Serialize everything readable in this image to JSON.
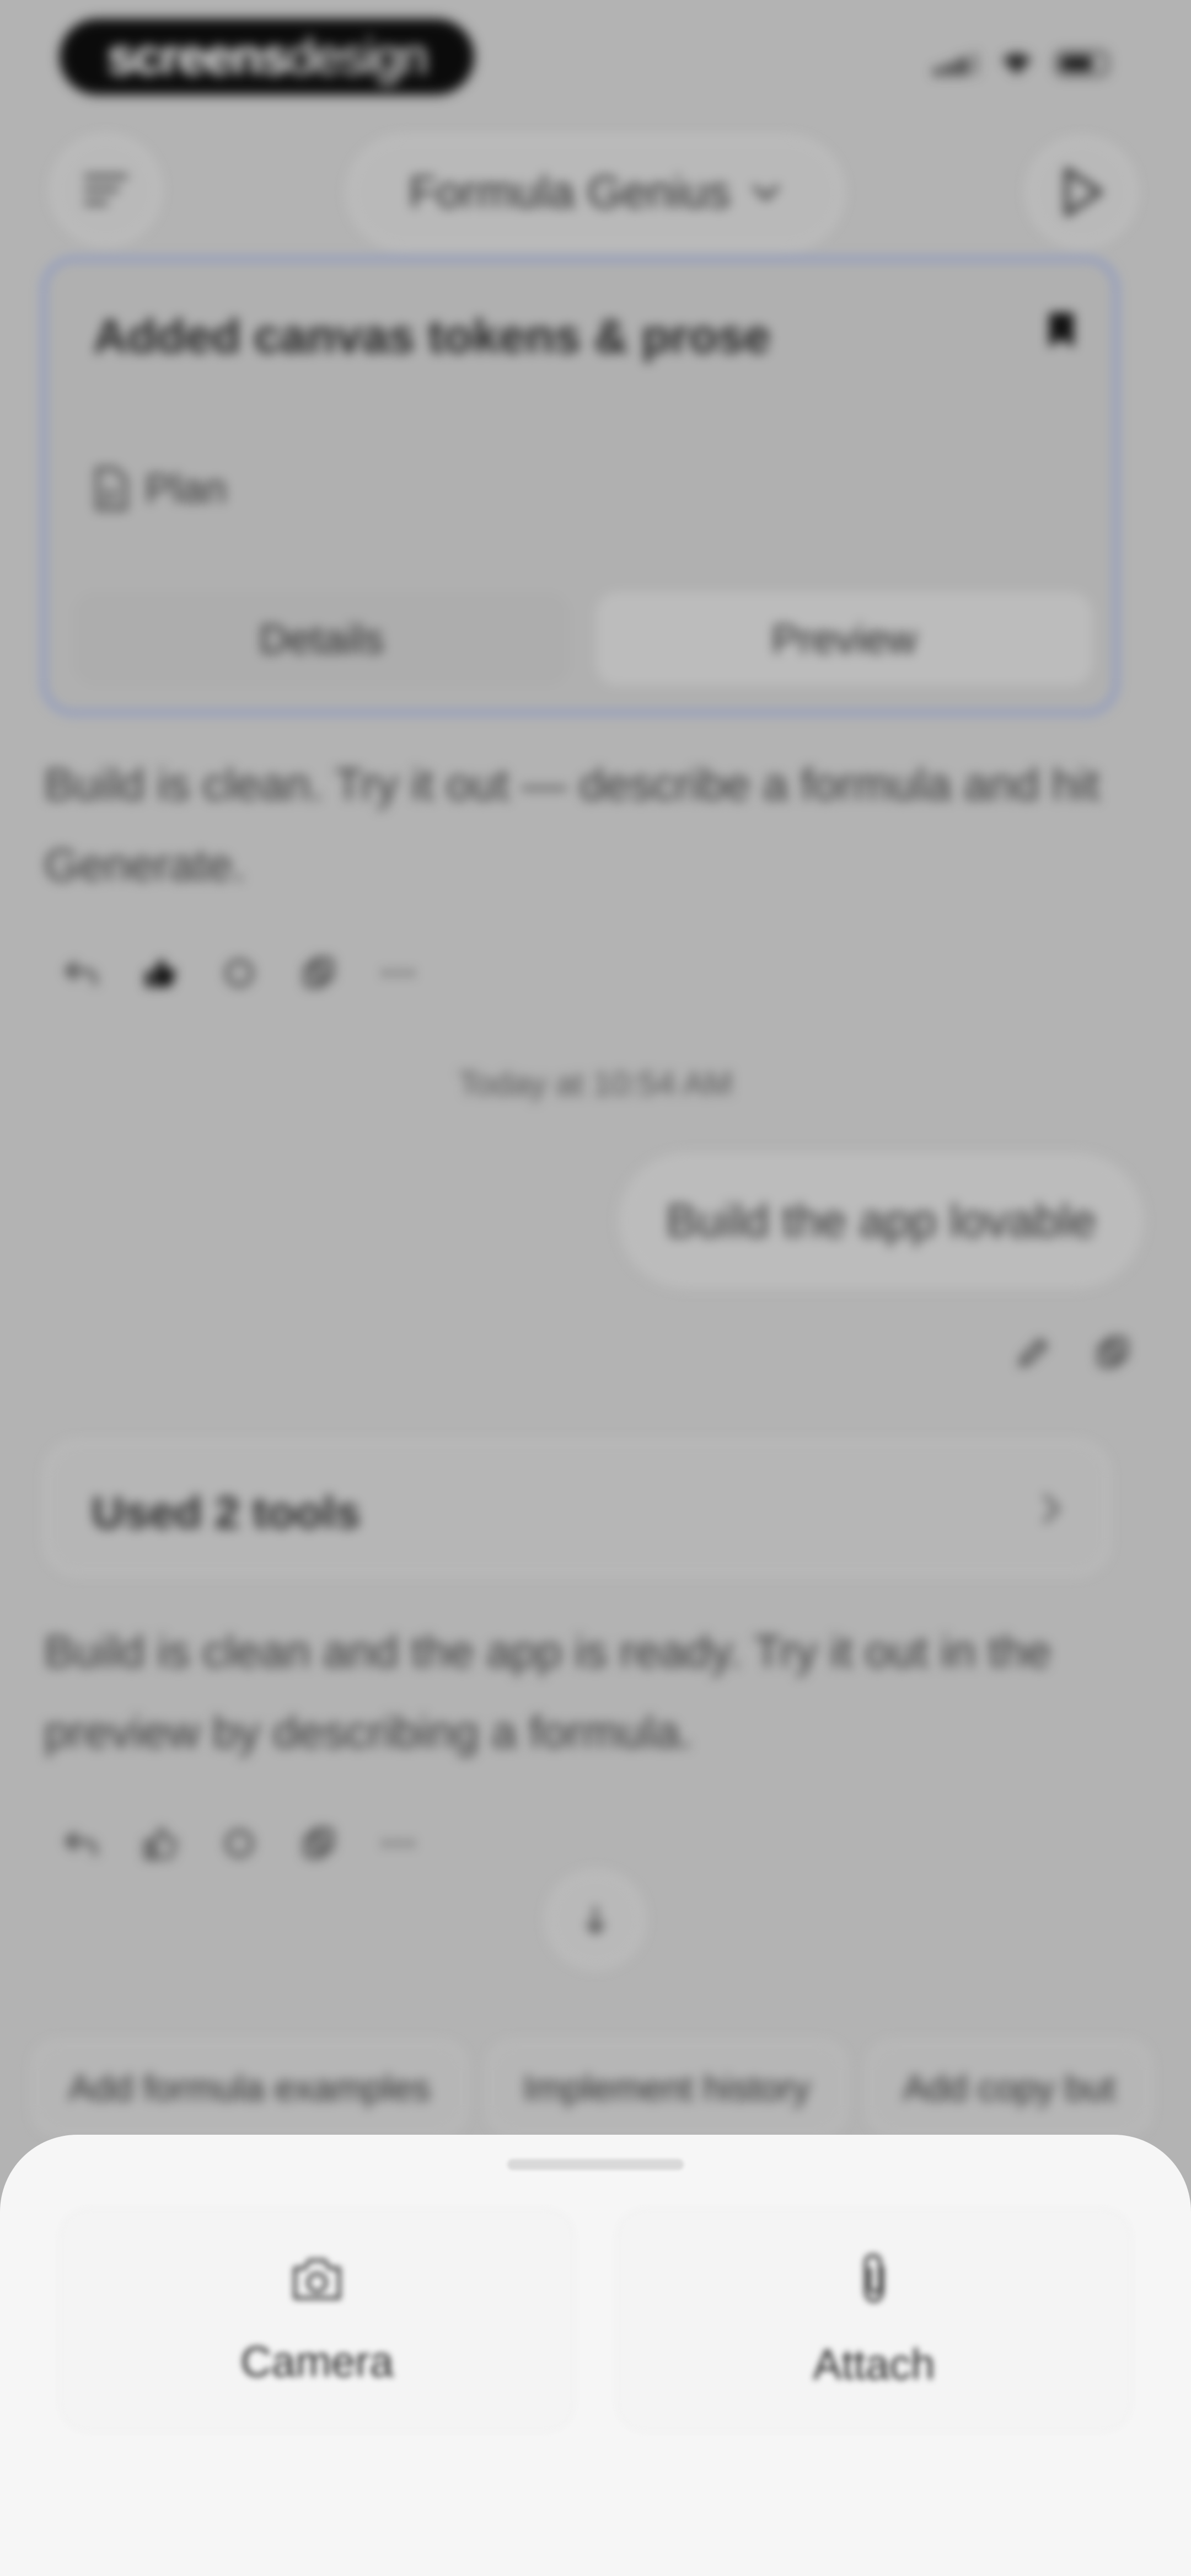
{
  "status_bar": {
    "brand_bold": "screens",
    "brand_light": "design"
  },
  "header": {
    "model_name": "Formula Genius",
    "menu_icon": "menu-lines-icon",
    "dropdown_icon": "chevron-down-icon",
    "play_icon": "play-icon"
  },
  "plan_card": {
    "title": "Added canvas tokens & prose",
    "tag": "Plan",
    "details_label": "Details",
    "preview_label": "Preview",
    "accent_color": "#7e8fc6"
  },
  "messages": {
    "assistant_1": "Build is clean. Try it out — describe a formula and hit Generate.",
    "timestamp": "Today at 10:54 AM",
    "user_1": "Build the app lovable",
    "tools_label": "Used 2 tools",
    "assistant_2": "Build is clean and the app is ready. Try it out in the preview by describing a formula."
  },
  "suggestions": [
    "Add formula examples",
    "Implement history",
    "Add copy but"
  ],
  "sheet": {
    "camera_label": "Camera",
    "attach_label": "Attach"
  }
}
